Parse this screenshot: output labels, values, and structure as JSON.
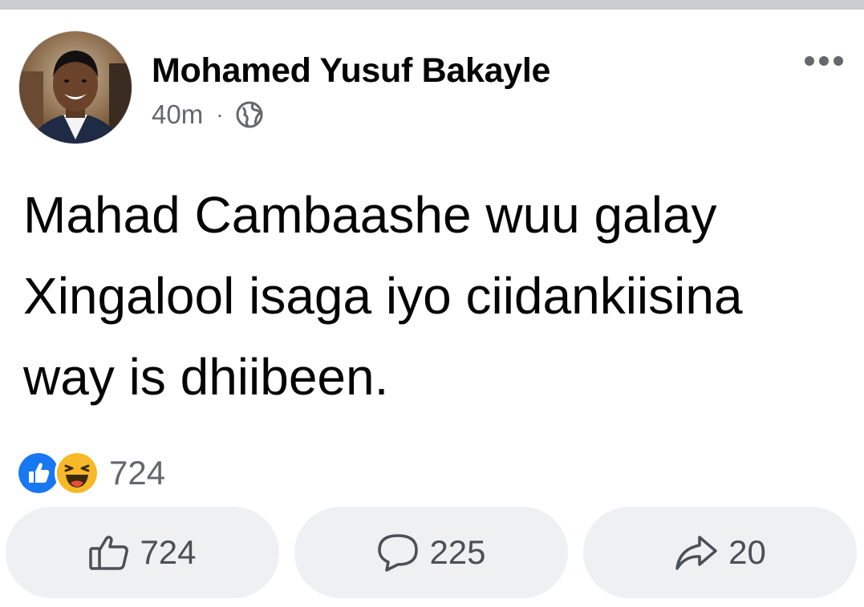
{
  "post": {
    "author": "Mohamed Yusuf Bakayle",
    "time": "40m",
    "separator": "·",
    "privacy_icon": "globe-icon",
    "more_icon": "more-options-icon",
    "text_lines": [
      "Mahad Cambaashe wuu galay",
      "Xingalool isaga iyo ciidankiisina",
      "way is dhiibeen."
    ]
  },
  "reactions": {
    "icons": [
      "like-reaction-icon",
      "haha-reaction-icon"
    ],
    "count": "724"
  },
  "actions": {
    "like_count": "724",
    "comment_count": "225",
    "share_count": "20"
  },
  "colors": {
    "like_blue": "#1877f2",
    "haha_yellow": "#f7b928",
    "text_primary": "#050505",
    "text_secondary": "#65676b",
    "button_bg": "#eff0f2"
  }
}
